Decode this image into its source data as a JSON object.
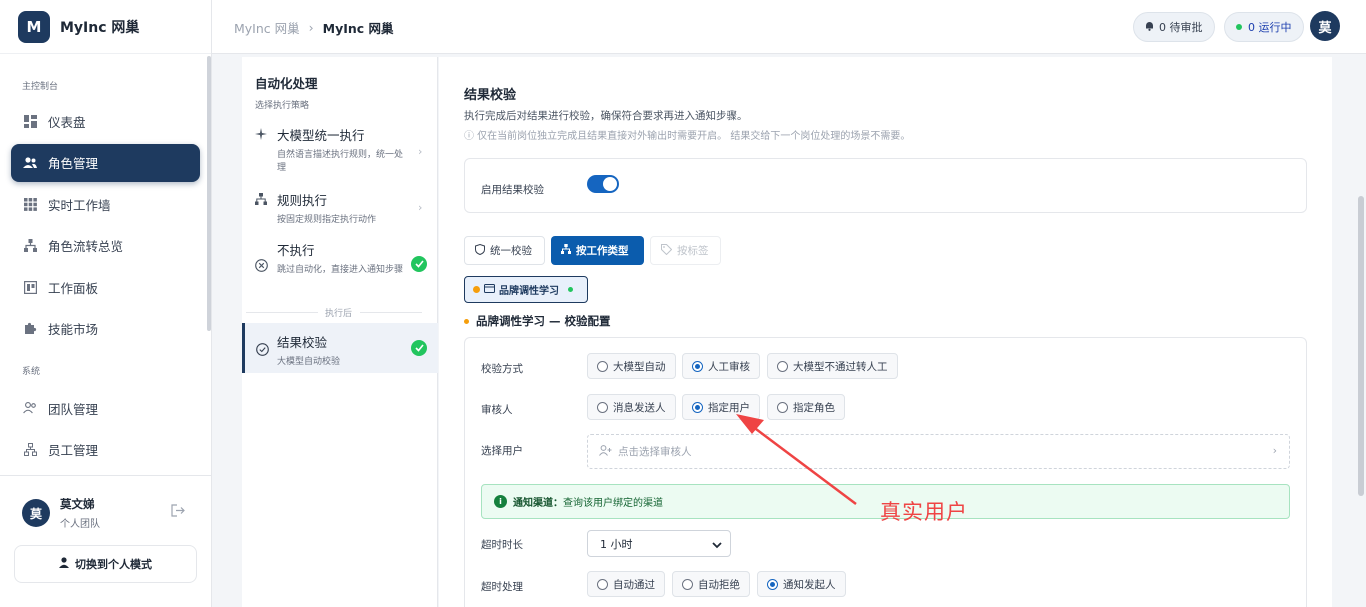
{
  "brand": {
    "logo_letter": "M",
    "name": "MyInc 网巢"
  },
  "sidebar": {
    "section_main": "主控制台",
    "section_system": "系统",
    "items": [
      {
        "label": "仪表盘",
        "icon": "dashboard-icon"
      },
      {
        "label": "角色管理",
        "icon": "users-icon",
        "active": true
      },
      {
        "label": "实时工作墙",
        "icon": "grid-icon"
      },
      {
        "label": "角色流转总览",
        "icon": "flow-icon"
      },
      {
        "label": "工作面板",
        "icon": "board-icon"
      },
      {
        "label": "技能市场",
        "icon": "puzzle-icon"
      }
    ],
    "system_items": [
      {
        "label": "团队管理",
        "icon": "team-icon"
      },
      {
        "label": "员工管理",
        "icon": "org-icon"
      }
    ],
    "user": {
      "avatar": "莫",
      "name": "莫文娣",
      "team": "个人团队"
    },
    "switch_label": "切换到个人模式"
  },
  "topbar": {
    "crumb_root": "MyInc 网巢",
    "crumb_current": "MyInc 网巢",
    "pending_label": "0 待审批",
    "running_label": "0 运行中",
    "avatar": "莫"
  },
  "strategy": {
    "title": "自动化处理",
    "subtitle": "选择执行策略",
    "options": [
      {
        "label": "大模型统一执行",
        "desc": "自然语言描述执行规则，统一处理"
      },
      {
        "label": "规则执行",
        "desc": "按固定规则指定执行动作"
      },
      {
        "label": "不执行",
        "desc": "跳过自动化，直接进入通知步骤"
      }
    ],
    "divider": "执行后",
    "after": {
      "label": "结果校验",
      "desc": "大模型自动校验"
    }
  },
  "main": {
    "title": "结果校验",
    "desc": "执行完成后对结果进行校验，确保符合要求再进入通知步骤。",
    "note": "ⓘ 仅在当前岗位独立完成且结果直接对外输出时需要开启。 结果交给下一个岗位处理的场景不需要。",
    "enable_label": "启用结果校验",
    "tabs": [
      "统一校验",
      "按工作类型",
      "按标签"
    ],
    "chip": "品牌调性学习",
    "cfg_title": "品牌调性学习 — 校验配置",
    "method_label": "校验方式",
    "method_options": [
      "大模型自动",
      "人工审核",
      "大模型不通过转人工"
    ],
    "reviewer_label": "审核人",
    "reviewer_options": [
      "消息发送人",
      "指定用户",
      "指定角色"
    ],
    "select_user_label": "选择用户",
    "select_user_placeholder": "点击选择审核人",
    "notice_bold": "通知渠道：",
    "notice_text": "查询该用户绑定的渠道",
    "timeout_label": "超时时长",
    "timeout_value": "1 小时",
    "timeout_action_label": "超时处理",
    "timeout_options": [
      "自动通过",
      "自动拒绝",
      "通知发起人"
    ]
  },
  "annotation": {
    "text": "真实用户",
    "color": "#ef4444"
  }
}
